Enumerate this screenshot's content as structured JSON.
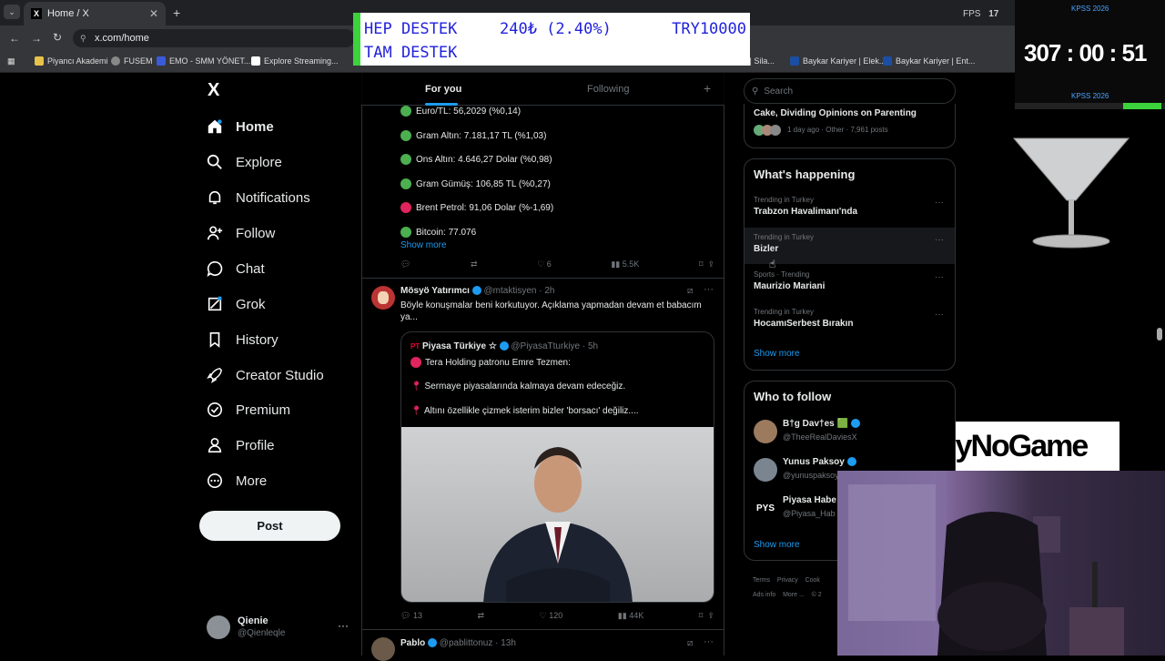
{
  "browser": {
    "tab_title": "Home / X",
    "tab_icon": "X",
    "address": "x.com/home",
    "fps_label": "FPS",
    "fps_value": "17",
    "bookmarks": [
      "Piyancı Akademi",
      "FUSEM",
      "EMO - SMM YÖNET...",
      "Explore Streaming...",
      "r | Sila...",
      "Baykar Kariyer | Elek...",
      "Baykar Kariyer | Ent..."
    ]
  },
  "banner": {
    "line1_left": "HEP DESTEK",
    "line1_mid": "240₺ (2.40%)",
    "line1_right": "TRY10000",
    "line2": "TAM DESTEK"
  },
  "timer": {
    "top_label": "KPSS 2026",
    "value": "307 : 00 : 51",
    "bottom_label": "KPSS 2026"
  },
  "sponsor": {
    "text": "ByNoGame"
  },
  "nav": {
    "logo": "X",
    "items": [
      "Home",
      "Explore",
      "Notifications",
      "Follow",
      "Chat",
      "Grok",
      "History",
      "Creator Studio",
      "Premium",
      "Profile",
      "More"
    ],
    "post_label": "Post",
    "user_name": "Qienie",
    "user_handle": "@Qienleqle"
  },
  "feed": {
    "tabs": [
      "For you",
      "Following"
    ],
    "tweet1": {
      "lines": [
        {
          "text": "Euro/TL: 56,2029 (%0,14)",
          "color": "#4caf50"
        },
        {
          "text": "Gram Altın: 7.181,17 TL (%1,03)",
          "color": "#4caf50"
        },
        {
          "text": "Ons Altın: 4.646,27 Dolar (%0,98)",
          "color": "#4caf50"
        },
        {
          "text": "Gram Gümüş: 106,85 TL (%0,27)",
          "color": "#4caf50"
        },
        {
          "text": "Brent Petrol: 91,06 Dolar (%-1,69)",
          "color": "#e0245e"
        },
        {
          "text": "Bitcoin: 77.076",
          "color": "#4caf50"
        }
      ],
      "show_more": "Show more",
      "likes": "6",
      "views": "5.5K"
    },
    "tweet2": {
      "name": "Mösyö Yatırımcı",
      "handle": "@mtaktisyen",
      "time": "· 2h",
      "text": "Böyle konuşmalar beni korkutuyor. Açıklama yapmadan devam et babacım ya...",
      "quote": {
        "name": "Piyasa Türkiye ☆",
        "handle": "@PiyasaTturkiye",
        "time": "· 5h",
        "line1": "Tera Holding patronu Emre Tezmen:",
        "line2": "Sermaye piyasalarında kalmaya devam edeceğiz.",
        "line3": "Altını özellikle çizmek isterim bizler 'borsacı' değiliz...."
      },
      "replies": "13",
      "likes": "120",
      "views": "44K"
    },
    "tweet3": {
      "name": "Pablo",
      "handle": "@pablittonuz",
      "time": "· 13h"
    }
  },
  "right": {
    "search_placeholder": "Search",
    "top_card": {
      "title": "Cake, Dividing Opinions on Parenting",
      "meta": "1 day ago · Other · 7,961 posts"
    },
    "happening": {
      "heading": "What's happening",
      "trends": [
        {
          "meta": "Trending in Turkey",
          "title": "Trabzon Havalimanı'nda"
        },
        {
          "meta": "Trending in Turkey",
          "title": "Bizler"
        },
        {
          "meta": "Sports · Trending",
          "title": "Maurizio Mariani"
        },
        {
          "meta": "Trending in Turkey",
          "title": "HocamıSerbest Bırakın"
        }
      ],
      "show_more": "Show more"
    },
    "follow": {
      "heading": "Who to follow",
      "people": [
        {
          "name": "B†g Dav†es 🟩",
          "handle": "@TheeRealDaviesX"
        },
        {
          "name": "Yunus Paksoy",
          "handle": "@yunuspaksoy"
        },
        {
          "name": "Piyasa Habe",
          "handle": "@Piyasa_Hab"
        }
      ],
      "avatar3": "PYS",
      "show_more": "Show more"
    },
    "footer": [
      "Terms",
      "Privacy",
      "Cook",
      "Ads info",
      "More ...",
      "© 2"
    ]
  }
}
